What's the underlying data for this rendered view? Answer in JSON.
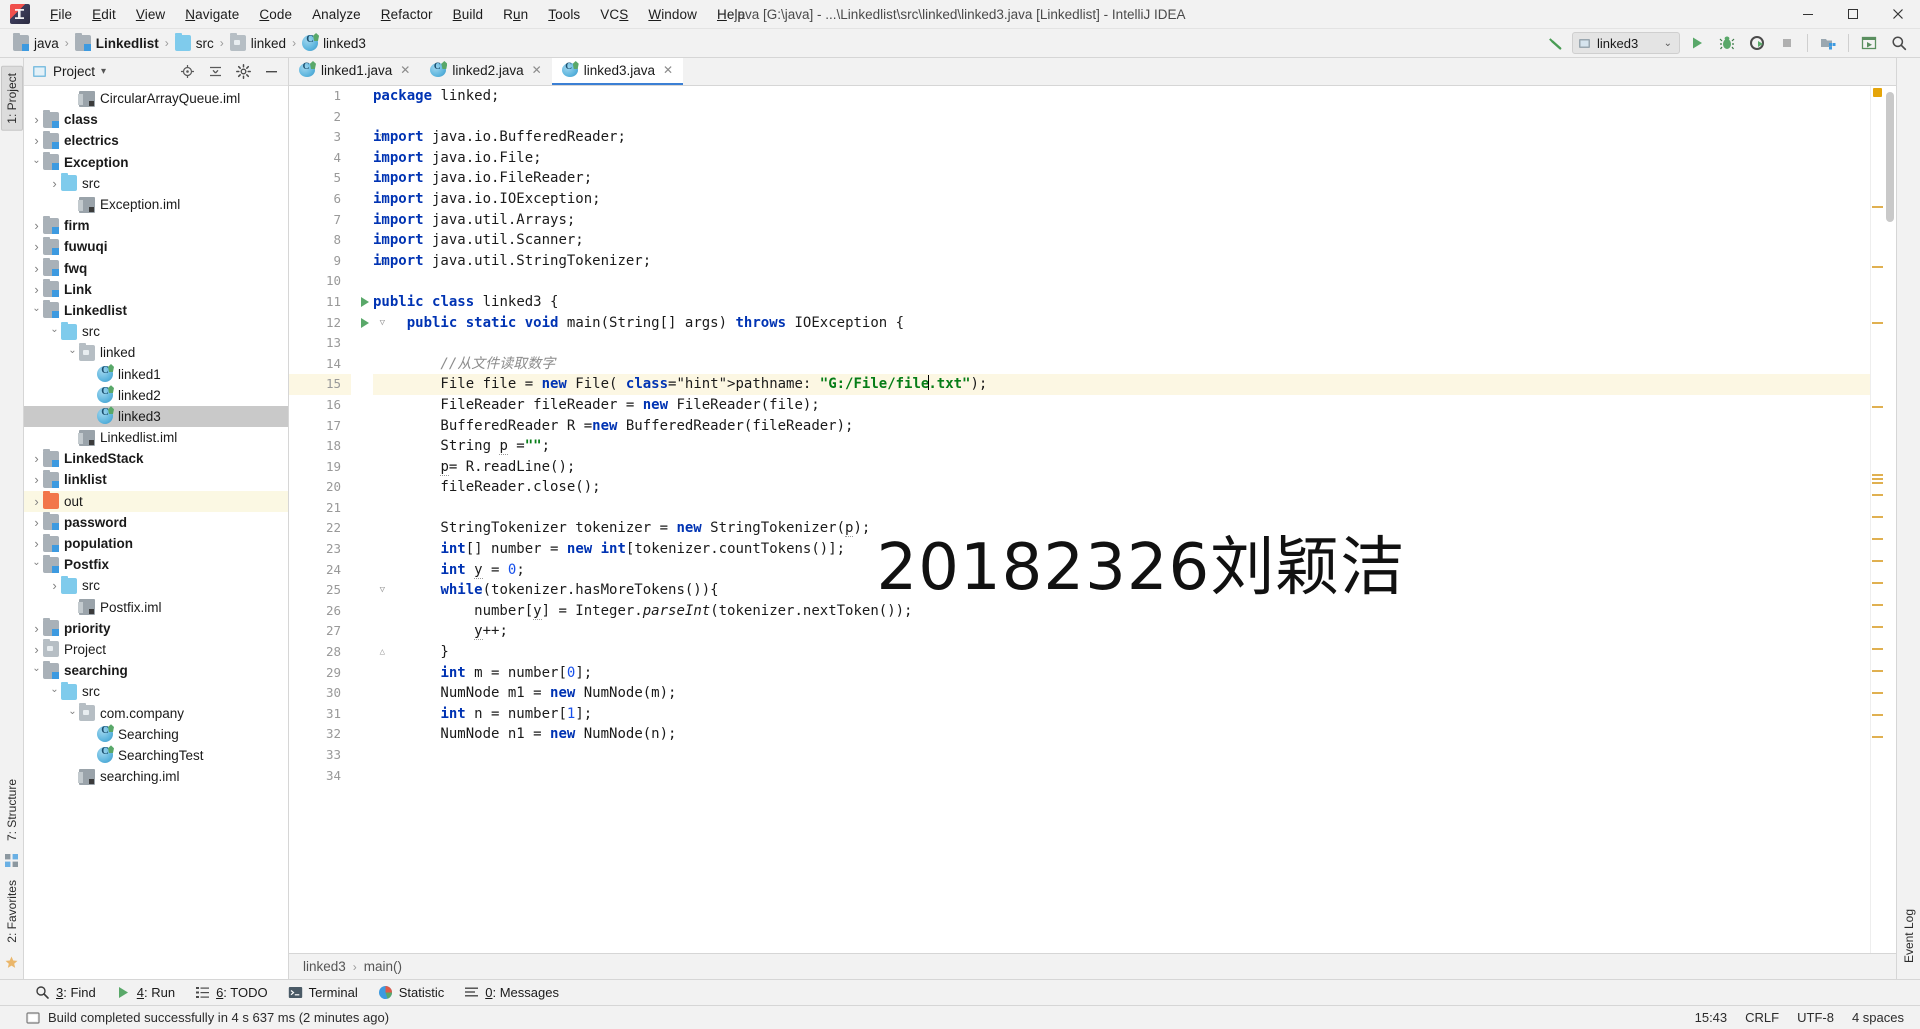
{
  "window": {
    "title": "java [G:\\java] - ...\\Linkedlist\\src\\linked\\linked3.java [Linkedlist] - IntelliJ IDEA",
    "minimize": "—",
    "maximize": "❐",
    "close": "✕"
  },
  "menu": [
    {
      "label": "File"
    },
    {
      "label": "Edit"
    },
    {
      "label": "View"
    },
    {
      "label": "Navigate"
    },
    {
      "label": "Code"
    },
    {
      "label": "Analyze"
    },
    {
      "label": "Refactor"
    },
    {
      "label": "Build"
    },
    {
      "label": "Run"
    },
    {
      "label": "Tools"
    },
    {
      "label": "VCS"
    },
    {
      "label": "Window"
    },
    {
      "label": "Help"
    }
  ],
  "breadcrumb": {
    "items": [
      {
        "label": "java",
        "icon": "module-icon",
        "bold": false
      },
      {
        "label": "Linkedlist",
        "icon": "module-icon",
        "bold": true
      },
      {
        "label": "src",
        "icon": "source-folder-icon",
        "bold": false
      },
      {
        "label": "linked",
        "icon": "package-folder-icon",
        "bold": false
      },
      {
        "label": "linked3",
        "icon": "java-class-icon",
        "bold": false
      }
    ],
    "separator": "›"
  },
  "nav_toolbar": {
    "build_icon": "hammer-build-icon",
    "run_config": "linked3",
    "run_config_chevron": "⌄",
    "run_icon": "run-play-icon",
    "debug_icon": "debug-bug-icon",
    "coverage_icon": "run-with-coverage-icon",
    "stop_icon": "stop-icon",
    "project_structure_icon": "project-structure-icon",
    "update_icon": "update-project-icon",
    "search_icon": "search-everywhere-icon"
  },
  "left_strip": [
    {
      "label": "1: Project",
      "selected": true
    },
    {
      "label": "7: Structure",
      "selected": false
    },
    {
      "label": "2: Favorites",
      "selected": false
    }
  ],
  "right_strip": [
    {
      "label": "Event Log",
      "selected": false
    }
  ],
  "project_panel": {
    "title": "Project",
    "chevron": "▾",
    "tools": [
      "locate-icon",
      "collapse-all-icon",
      "settings-gear-icon",
      "hide-icon"
    ],
    "tree": [
      {
        "label": "CircularArrayQueue.iml",
        "indent": 3,
        "arrow": "none",
        "icon": "iml-file-icon",
        "bold": false,
        "state": "normal"
      },
      {
        "label": "class",
        "indent": 1,
        "arrow": "collapsed",
        "icon": "module-icon",
        "bold": true,
        "state": "normal"
      },
      {
        "label": "electrics",
        "indent": 1,
        "arrow": "collapsed",
        "icon": "module-icon",
        "bold": true,
        "state": "normal"
      },
      {
        "label": "Exception",
        "indent": 1,
        "arrow": "expanded",
        "icon": "module-icon",
        "bold": true,
        "state": "normal"
      },
      {
        "label": "src",
        "indent": 2,
        "arrow": "collapsed",
        "icon": "source-folder-icon",
        "bold": false,
        "state": "normal"
      },
      {
        "label": "Exception.iml",
        "indent": 3,
        "arrow": "none",
        "icon": "iml-file-icon",
        "bold": false,
        "state": "normal"
      },
      {
        "label": "firm",
        "indent": 1,
        "arrow": "collapsed",
        "icon": "module-icon",
        "bold": true,
        "state": "normal"
      },
      {
        "label": "fuwuqi",
        "indent": 1,
        "arrow": "collapsed",
        "icon": "module-icon",
        "bold": true,
        "state": "normal"
      },
      {
        "label": "fwq",
        "indent": 1,
        "arrow": "collapsed",
        "icon": "module-icon",
        "bold": true,
        "state": "normal"
      },
      {
        "label": "Link",
        "indent": 1,
        "arrow": "collapsed",
        "icon": "module-icon",
        "bold": true,
        "state": "normal"
      },
      {
        "label": "Linkedlist",
        "indent": 1,
        "arrow": "expanded",
        "icon": "module-icon",
        "bold": true,
        "state": "normal"
      },
      {
        "label": "src",
        "indent": 2,
        "arrow": "expanded",
        "icon": "source-folder-icon",
        "bold": false,
        "state": "normal"
      },
      {
        "label": "linked",
        "indent": 3,
        "arrow": "expanded",
        "icon": "package-folder-icon",
        "bold": false,
        "state": "normal"
      },
      {
        "label": "linked1",
        "indent": 4,
        "arrow": "none",
        "icon": "java-class-icon",
        "bold": false,
        "state": "normal"
      },
      {
        "label": "linked2",
        "indent": 4,
        "arrow": "none",
        "icon": "java-class-icon",
        "bold": false,
        "state": "normal"
      },
      {
        "label": "linked3",
        "indent": 4,
        "arrow": "none",
        "icon": "java-class-icon",
        "bold": false,
        "state": "selected"
      },
      {
        "label": "Linkedlist.iml",
        "indent": 3,
        "arrow": "none",
        "icon": "iml-file-icon",
        "bold": false,
        "state": "normal"
      },
      {
        "label": "LinkedStack",
        "indent": 1,
        "arrow": "collapsed",
        "icon": "module-icon",
        "bold": true,
        "state": "normal"
      },
      {
        "label": "linklist",
        "indent": 1,
        "arrow": "collapsed",
        "icon": "module-icon",
        "bold": true,
        "state": "normal"
      },
      {
        "label": "out",
        "indent": 1,
        "arrow": "collapsed",
        "icon": "excluded-folder-icon",
        "bold": false,
        "state": "excluded"
      },
      {
        "label": "password",
        "indent": 1,
        "arrow": "collapsed",
        "icon": "module-icon",
        "bold": true,
        "state": "normal"
      },
      {
        "label": "population",
        "indent": 1,
        "arrow": "collapsed",
        "icon": "module-icon",
        "bold": true,
        "state": "normal"
      },
      {
        "label": "Postfix",
        "indent": 1,
        "arrow": "expanded",
        "icon": "module-icon",
        "bold": true,
        "state": "normal"
      },
      {
        "label": "src",
        "indent": 2,
        "arrow": "collapsed",
        "icon": "source-folder-icon",
        "bold": false,
        "state": "normal"
      },
      {
        "label": "Postfix.iml",
        "indent": 3,
        "arrow": "none",
        "icon": "iml-file-icon",
        "bold": false,
        "state": "normal"
      },
      {
        "label": "priority",
        "indent": 1,
        "arrow": "collapsed",
        "icon": "module-icon",
        "bold": true,
        "state": "normal"
      },
      {
        "label": "Project",
        "indent": 1,
        "arrow": "collapsed",
        "icon": "plain-folder-icon",
        "bold": false,
        "state": "normal"
      },
      {
        "label": "searching",
        "indent": 1,
        "arrow": "expanded",
        "icon": "module-icon",
        "bold": true,
        "state": "normal"
      },
      {
        "label": "src",
        "indent": 2,
        "arrow": "expanded",
        "icon": "source-folder-icon",
        "bold": false,
        "state": "normal"
      },
      {
        "label": "com.company",
        "indent": 3,
        "arrow": "expanded",
        "icon": "package-folder-icon",
        "bold": false,
        "state": "normal"
      },
      {
        "label": "Searching",
        "indent": 4,
        "arrow": "none",
        "icon": "java-class-icon",
        "bold": false,
        "state": "normal"
      },
      {
        "label": "SearchingTest",
        "indent": 4,
        "arrow": "none",
        "icon": "java-class-icon",
        "bold": false,
        "state": "normal"
      },
      {
        "label": "searching.iml",
        "indent": 3,
        "arrow": "none",
        "icon": "iml-file-icon",
        "bold": false,
        "state": "normal"
      }
    ]
  },
  "editor_tabs": [
    {
      "label": "linked1.java",
      "active": false,
      "close": "✕"
    },
    {
      "label": "linked2.java",
      "active": false,
      "close": "✕"
    },
    {
      "label": "linked3.java",
      "active": true,
      "close": "✕"
    }
  ],
  "editor": {
    "watermark": "20182326刘颖洁",
    "first_line": 1,
    "lines": [
      {
        "n": 1,
        "runmark": false,
        "fold": "",
        "highlight": false
      },
      {
        "n": 2,
        "runmark": false,
        "fold": "",
        "highlight": false
      },
      {
        "n": 3,
        "runmark": false,
        "fold": "top",
        "highlight": false
      },
      {
        "n": 4,
        "runmark": false,
        "fold": "",
        "highlight": false
      },
      {
        "n": 5,
        "runmark": false,
        "fold": "",
        "highlight": false
      },
      {
        "n": 6,
        "runmark": false,
        "fold": "",
        "highlight": false
      },
      {
        "n": 7,
        "runmark": false,
        "fold": "",
        "highlight": false
      },
      {
        "n": 8,
        "runmark": false,
        "fold": "",
        "highlight": false
      },
      {
        "n": 9,
        "runmark": false,
        "fold": "bottom",
        "highlight": false
      },
      {
        "n": 10,
        "runmark": false,
        "fold": "",
        "highlight": false
      },
      {
        "n": 11,
        "runmark": true,
        "fold": "",
        "highlight": false
      },
      {
        "n": 12,
        "runmark": true,
        "fold": "top",
        "highlight": false
      },
      {
        "n": 13,
        "runmark": false,
        "fold": "",
        "highlight": false
      },
      {
        "n": 14,
        "runmark": false,
        "fold": "",
        "highlight": false
      },
      {
        "n": 15,
        "runmark": false,
        "fold": "",
        "highlight": true
      },
      {
        "n": 16,
        "runmark": false,
        "fold": "",
        "highlight": false
      },
      {
        "n": 17,
        "runmark": false,
        "fold": "",
        "highlight": false
      },
      {
        "n": 18,
        "runmark": false,
        "fold": "",
        "highlight": false
      },
      {
        "n": 19,
        "runmark": false,
        "fold": "",
        "highlight": false
      },
      {
        "n": 20,
        "runmark": false,
        "fold": "",
        "highlight": false
      },
      {
        "n": 21,
        "runmark": false,
        "fold": "",
        "highlight": false
      },
      {
        "n": 22,
        "runmark": false,
        "fold": "",
        "highlight": false
      },
      {
        "n": 23,
        "runmark": false,
        "fold": "",
        "highlight": false
      },
      {
        "n": 24,
        "runmark": false,
        "fold": "",
        "highlight": false
      },
      {
        "n": 25,
        "runmark": false,
        "fold": "top",
        "highlight": false
      },
      {
        "n": 26,
        "runmark": false,
        "fold": "",
        "highlight": false
      },
      {
        "n": 27,
        "runmark": false,
        "fold": "",
        "highlight": false
      },
      {
        "n": 28,
        "runmark": false,
        "fold": "bottom",
        "highlight": false
      },
      {
        "n": 29,
        "runmark": false,
        "fold": "",
        "highlight": false
      },
      {
        "n": 30,
        "runmark": false,
        "fold": "",
        "highlight": false
      },
      {
        "n": 31,
        "runmark": false,
        "fold": "",
        "highlight": false
      },
      {
        "n": 32,
        "runmark": false,
        "fold": "",
        "highlight": false
      },
      {
        "n": 33,
        "runmark": false,
        "fold": "",
        "highlight": false
      },
      {
        "n": 34,
        "runmark": false,
        "fold": "",
        "highlight": false
      }
    ],
    "code_text": [
      "package linked;",
      "",
      "import java.io.BufferedReader;",
      "import java.io.File;",
      "import java.io.FileReader;",
      "import java.io.IOException;",
      "import java.util.Arrays;",
      "import java.util.Scanner;",
      "import java.util.StringTokenizer;",
      "",
      "public class linked3 {",
      "    public static void main(String[] args) throws IOException {",
      "",
      "        //从文件读取数字",
      "        File file = new File( pathname: \"G:/File/file.txt\");",
      "        FileReader fileReader = new FileReader(file);",
      "        BufferedReader R =new BufferedReader(fileReader);",
      "        String p =\"\";",
      "        p= R.readLine();",
      "        fileReader.close();",
      "",
      "        StringTokenizer tokenizer = new StringTokenizer(p);",
      "        int[] number = new int[tokenizer.countTokens()];",
      "        int y = 0;",
      "        while(tokenizer.hasMoreTokens()){",
      "            number[y] = Integer.parseInt(tokenizer.nextToken());",
      "            y++;",
      "        }",
      "        int m = number[0];",
      "        NumNode m1 = new NumNode(m);",
      "        int n = number[1];",
      "        NumNode n1 = new NumNode(n);",
      "",
      ""
    ]
  },
  "editor_breadcrumb": {
    "items": [
      "linked3",
      "main()"
    ],
    "separator": "›"
  },
  "tool_windows": [
    {
      "num": "3",
      "label": "Find",
      "icon": "find-magnifier-icon"
    },
    {
      "num": "4",
      "label": "Run",
      "icon": "run-play-icon"
    },
    {
      "num": "6",
      "label": "TODO",
      "icon": "todo-list-icon"
    },
    {
      "num": "",
      "label": "Terminal",
      "icon": "terminal-icon"
    },
    {
      "num": "",
      "label": "Statistic",
      "icon": "statistic-icon"
    },
    {
      "num": "0",
      "label": "Messages",
      "icon": "messages-icon"
    }
  ],
  "status_bar": {
    "message_icon": "build-status-icon",
    "message": "Build completed successfully in 4 s 637 ms (2 minutes ago)",
    "position": "15:43",
    "line_sep": "CRLF",
    "encoding": "UTF-8",
    "indent": "4 spaces"
  },
  "colors": {
    "accent_blue": "#3b7fd4",
    "keyword": "#0033b3",
    "string": "#067d17",
    "number": "#1750eb",
    "comment": "#8c8c8c",
    "run_green": "#59a869",
    "highlight_line": "#fcf7e3",
    "selection_gray": "#c9c9c9",
    "excluded_yellow": "#fbf8e3",
    "excluded_orange": "#f2764a"
  }
}
